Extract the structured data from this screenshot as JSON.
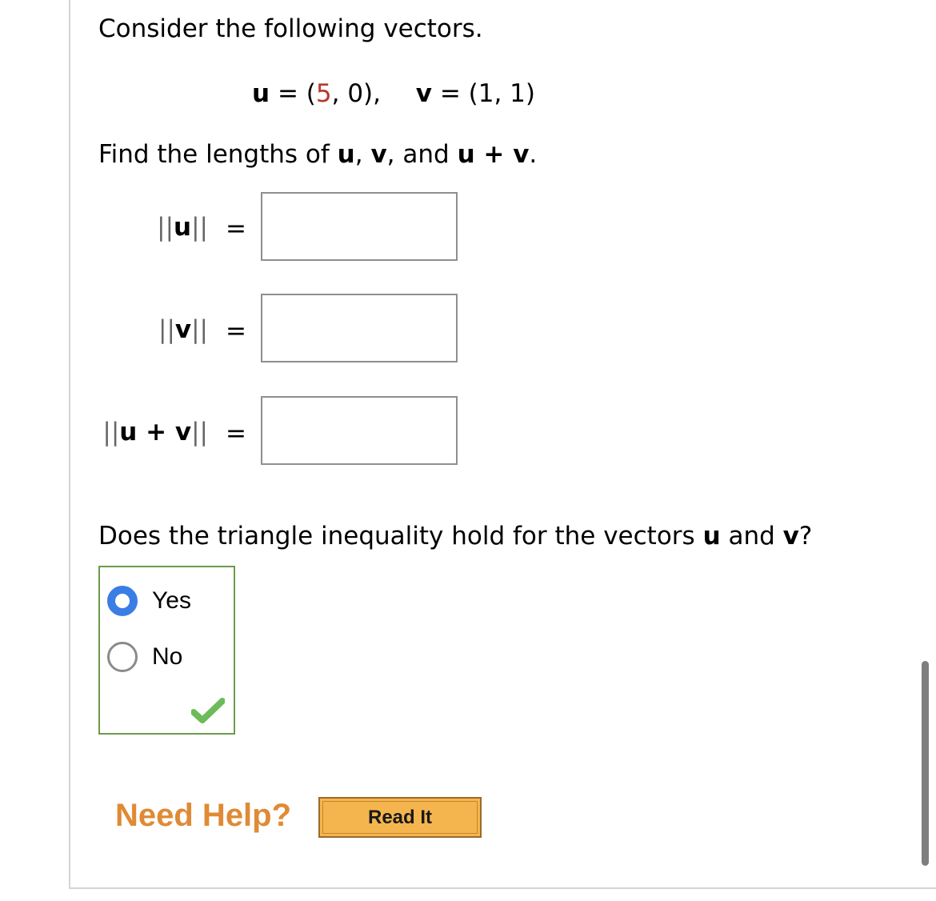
{
  "question": {
    "intro": "Consider the following vectors.",
    "vectors": {
      "u_label": "u",
      "equals": "=",
      "u_open": "(",
      "u_x": "5",
      "u_rest": ", 0),",
      "v_label": "v",
      "v_value": "(1, 1)"
    },
    "prompt_prefix": "Find the lengths of ",
    "prompt_u": "u",
    "prompt_sep1": ", ",
    "prompt_v": "v",
    "prompt_sep2": ", and ",
    "prompt_sum": "u + v",
    "prompt_end": ".",
    "answers": [
      {
        "label_bold": "u",
        "value": ""
      },
      {
        "label_bold": "v",
        "value": ""
      },
      {
        "label_bold": "u + v",
        "value": ""
      }
    ],
    "norm_bars": "||",
    "eq": "="
  },
  "triangle": {
    "prefix": "Does the triangle inequality hold for the vectors ",
    "u": "u",
    "and": " and ",
    "v": "v",
    "end": "?",
    "options": [
      {
        "label": "Yes",
        "selected": true
      },
      {
        "label": "No",
        "selected": false
      }
    ],
    "status_icon": "check-icon",
    "status_color": "#6dbb5a"
  },
  "help": {
    "label": "Need Help?",
    "button": "Read It"
  },
  "colors": {
    "accent_red": "#b5382f",
    "radio_selected": "#3a7ee4",
    "group_border": "#6b9a4b",
    "help_orange": "#e08a35",
    "button_fill": "#f5b54e"
  }
}
